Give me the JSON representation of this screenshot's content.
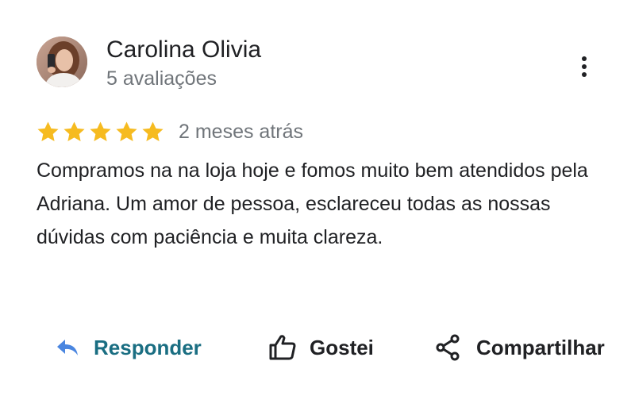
{
  "review": {
    "author_name": "Carolina Olivia",
    "author_meta": "5 avaliações",
    "rating": 5,
    "rating_max": 5,
    "date": "2 meses atrás",
    "text": "Compramos na na loja hoje e fomos muito bem atendidos pela Adriana. Um amor de pessoa, esclareceu todas as nossas dúvidas com paciência e muita clareza.",
    "star_color": "#f6bb20"
  },
  "actions": {
    "reply_label": "Responder",
    "like_label": "Gostei",
    "share_label": "Compartilhar",
    "reply_color": "#1a6e82",
    "reply_icon_color": "#4a86e0"
  },
  "icons": {
    "more": "more-vertical-icon",
    "reply": "reply-arrow-icon",
    "like": "thumbs-up-icon",
    "share": "share-icon"
  }
}
